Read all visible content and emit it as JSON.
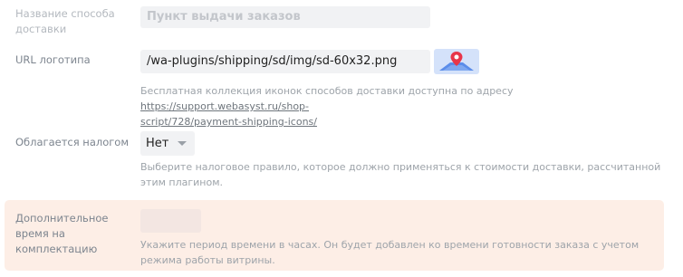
{
  "fields": {
    "name": {
      "label": "Название способа доставки",
      "value": "Пункт выдачи заказов"
    },
    "logo": {
      "label": "URL логотипа",
      "value": "/wa-plugins/shipping/sd/img/sd-60x32.png",
      "preview_icon": "map-pin-icon",
      "hint_prefix": "Бесплатная коллекция иконок способов доставки доступна по адресу",
      "hint_link": "https://support.webasyst.ru/shop-script/728/payment-shipping-icons/",
      "hint_link_line1": "https://support.webasyst.ru/shop-",
      "hint_link_line2": "script/728/payment-shipping-icons/"
    },
    "tax": {
      "label": "Облагается налогом",
      "selected": "Нет",
      "hint": "Выберите налоговое правило, которое должно применяться к стоимости доставки, рассчитанной этим плагином."
    },
    "prep_time": {
      "label": "Дополнительное время на комплектацию",
      "value": "",
      "hint": "Укажите период времени в часах. Он будет добавлен ко времени готовности заказа с учетом режима работы витрины."
    }
  },
  "colors": {
    "highlight_bg": "#fdeee6",
    "input_bg": "#f1f2f4",
    "pin_red": "#e8364a"
  }
}
